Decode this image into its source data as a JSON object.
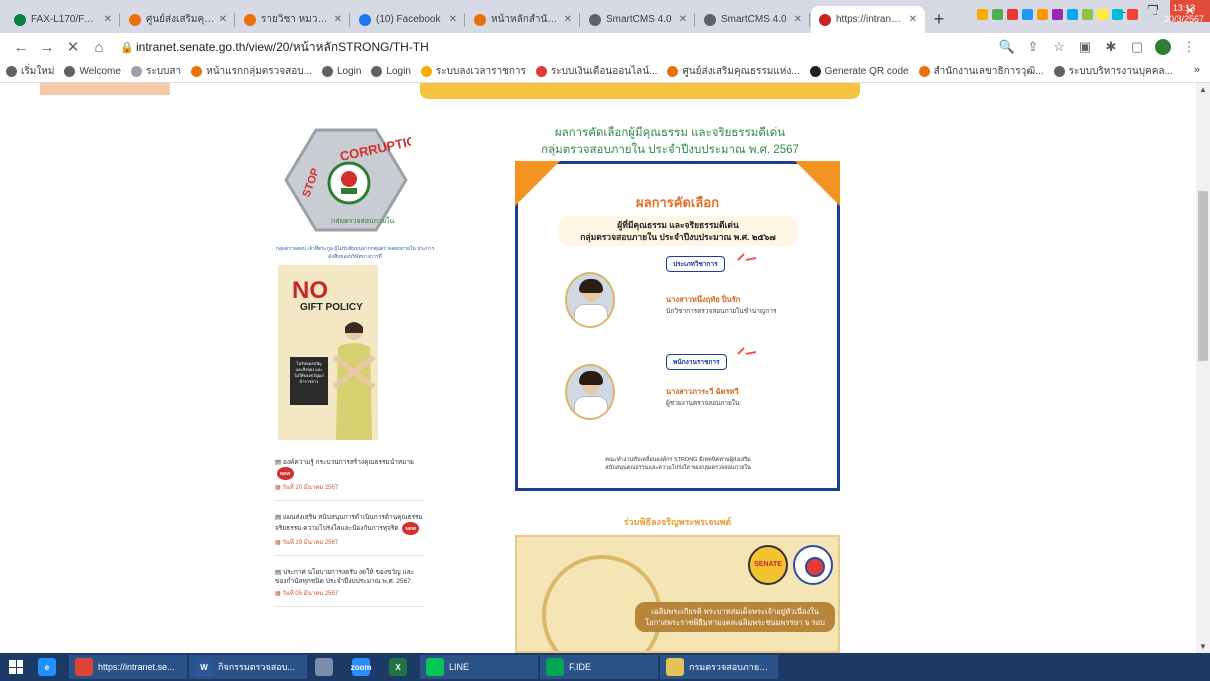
{
  "browser": {
    "tabs": [
      {
        "title": "FAX-L170/FAX-L150",
        "color": "#0b8043"
      },
      {
        "title": "ศูนย์ส่งเสริมคุณธรรมแห่ง",
        "color": "#e8710a"
      },
      {
        "title": "รายวิชา หมวดการสอบ",
        "color": "#e8710a"
      },
      {
        "title": "(10) Facebook",
        "color": "#1877f2"
      },
      {
        "title": "หน้าหลักสำนักงานฯ",
        "color": "#e8710a"
      },
      {
        "title": "SmartCMS 4.0",
        "color": "#5f6368"
      },
      {
        "title": "SmartCMS 4.0",
        "color": "#5f6368"
      },
      {
        "title": "https://intranet.sen",
        "color": "#c62828"
      }
    ],
    "url": "intranet.senate.go.th/view/20/หน้าหลักSTRONG/TH-TH",
    "bookmarks": [
      {
        "label": "เริ่มใหม่",
        "color": "#5f6368"
      },
      {
        "label": "Welcome",
        "color": "#5f6368"
      },
      {
        "label": "ระบบสา",
        "color": "#9aa0a6"
      },
      {
        "label": "หน้าแรกกลุ่มตรวจสอบ...",
        "color": "#e8710a"
      },
      {
        "label": "Login",
        "color": "#5f6368"
      },
      {
        "label": "Login",
        "color": "#5f6368"
      },
      {
        "label": "ระบบลงเวลาราชการ",
        "color": "#f9ab00"
      },
      {
        "label": "ระบบเงินเดือนออนไลน์...",
        "color": "#e53935"
      },
      {
        "label": "ศูนย์ส่งเสริมคุณธรรมแห่ง...",
        "color": "#e8710a"
      },
      {
        "label": "Generate QR code",
        "color": "#202124"
      },
      {
        "label": "สำนักงานเลขาธิการวุฒิ...",
        "color": "#e8710a"
      },
      {
        "label": "ระบบบริหารงานบุคคล...",
        "color": "#5f6368"
      }
    ]
  },
  "sidebar": {
    "logo_alt": "STOP CORRUPTION",
    "caption": "กลุ่มตรวจสอบ เจ้าที่ตระกูล ผู้ไม่รับสินบนจากกลุ่มตรวจสอบภายใน ประการดังสืบของบริษัทบางการที่",
    "poster": {
      "no": "NO",
      "gift": "GIFT POLICY",
      "dark_text": "ไม่รับของขวัญและสิ่งของ และไม่ให้ของขวัญแก่ ข้าราชการ"
    },
    "news": [
      {
        "text": "องค์ความรู้ กระบวนการสร้างคุณธรรมนำหมาย",
        "new": "NEW",
        "date": "วันที่ 20 มีนาคม 2567"
      },
      {
        "text": "แผนส่งเสริม สนับสนุนการดำเนินการด้านคุณธรรม จริยธรรม ความโปร่งใสและป้องกันการทุจริต",
        "new": "NEW",
        "date": "วันที่ 19 มีนาคม 2567"
      },
      {
        "text": "ประกาศ นโยบายการงดรับ งดให้ ของขวัญ และของกำนัลทุกชนิด ประจำปีงบประมาณ พ.ศ. 2567",
        "new": "",
        "date": "วันที่ 05 มีนาคม 2567"
      }
    ]
  },
  "main": {
    "title_line1": "ผลการคัดเลือกผู้มีคุณธรรม และจริยธรรมดีเด่น",
    "title_line2": "กลุ่มตรวจสอบภายใน ประจำปีงบประมาณ พ.ศ. 2567",
    "card": {
      "heading": "ผลการคัดเลือก",
      "sub1": "ผู้ที่มีคุณธรรม และจริยธรรมดีเด่น",
      "sub2": "กลุ่มตรวจสอบภายใน ประจำปีงบประมาณ พ.ศ. ๒๕๖๗",
      "cat1": "ประเภทวิชาการ",
      "name1": "นางสาวหนึ่งฤทัย ปิ่นรัก",
      "role1": "นักวิชาการตรวจสอบภายในชำนาญการ",
      "cat2": "พนักงานราชการ",
      "name2": "นางสาวภาระวี ฉัตรทวี",
      "role2": "ผู้ช่วยงานตรวจสอบภายใน",
      "footer1": "คณะทำงานขับเคลื่อนองค์กร STRONG มีเทคนิคท่านผู้ส่งเสริม",
      "footer2": "สนับสนุนคุณธรรมและความโปร่งใส ของกลุ่มตรวจสอบภายใน"
    },
    "section2_title": "ร่วมพิธีลงจริญพระพรเจนพต์",
    "banner": {
      "senate": "SENATE",
      "slogan": "เฉลิมพระเกียรติ พระบาทสมเด็จพระเจ้าอยู่หัวเนื่องในโอกาสพระราชพิธีมหามงคลเฉลิมพระชนมพรรษา ๖ รอบ"
    }
  },
  "taskbar": {
    "apps": [
      {
        "label": "https://intranet.se...",
        "color": "#db4437",
        "glyph": "",
        "open": true
      },
      {
        "label": "กิจกรรมตรวจสอบ...",
        "color": "#2b579a",
        "glyph": "W",
        "open": true
      },
      {
        "label": "",
        "color": "#7b8da8",
        "glyph": "",
        "open": false
      },
      {
        "label": "",
        "color": "#2d8cff",
        "glyph": "zoom",
        "open": false
      },
      {
        "label": "",
        "color": "#217346",
        "glyph": "X",
        "open": false
      },
      {
        "label": "LINE",
        "color": "#06c755",
        "glyph": "",
        "open": true
      },
      {
        "label": "F.IDE",
        "color": "#00a651",
        "glyph": "",
        "open": true
      },
      {
        "label": "กรมตรวจสอบภายใน...",
        "color": "#e6c35a",
        "glyph": "",
        "open": true
      }
    ],
    "time": "13:13",
    "date": "20/3/2567"
  }
}
